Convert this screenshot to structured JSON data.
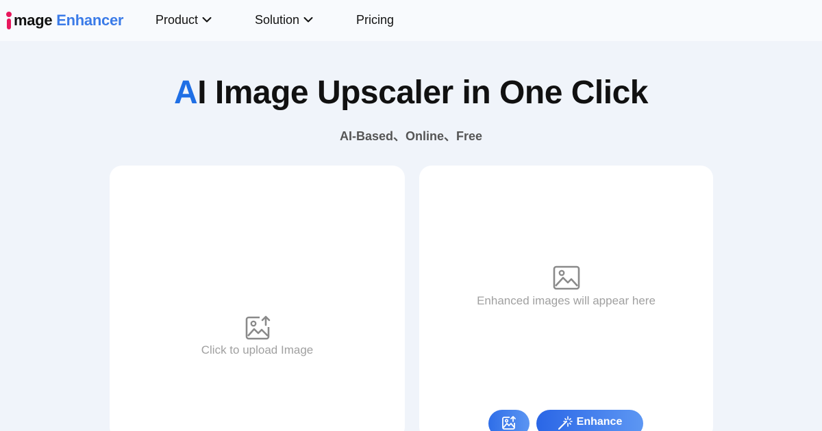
{
  "logo": {
    "main": "mage",
    "accent": "Enhancer",
    "alt": "image Enhancer"
  },
  "nav": {
    "items": [
      {
        "label": "Product",
        "has_dropdown": true,
        "icon": "chevron-down-icon"
      },
      {
        "label": "Solution",
        "has_dropdown": true,
        "icon": "chevron-down-icon"
      },
      {
        "label": "Pricing",
        "has_dropdown": false
      }
    ]
  },
  "hero": {
    "title_accent": "A",
    "title_rest": "I Image Upscaler in One Click",
    "subtitle": "AI-Based、Online、Free"
  },
  "upload_panel": {
    "icon": "image-upload-icon",
    "text": "Click to upload Image"
  },
  "result_panel": {
    "icon": "image-placeholder-icon",
    "text": "Enhanced images will appear here",
    "upload_button_icon": "image-upload-icon",
    "enhance_button": {
      "label": "Enhance",
      "icon": "magic-wand-icon"
    }
  },
  "colors": {
    "accent_blue": "#1f6fe5",
    "logo_blue": "#3b7be8",
    "logo_pink": "#e8175d",
    "background": "#f0f4fa",
    "button_gradient_start": "#2a66e6",
    "button_gradient_end": "#5d97f3"
  }
}
